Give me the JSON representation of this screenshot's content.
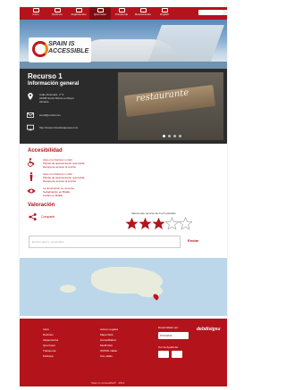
{
  "nav": {
    "items": [
      {
        "label": "Inicio",
        "icon": "home-icon"
      },
      {
        "label": "Destinos",
        "icon": "map-icon"
      },
      {
        "label": "Alojamientos",
        "icon": "bed-icon"
      },
      {
        "label": "Qué hacer",
        "icon": "camera-icon",
        "active": true
      },
      {
        "label": "Transporte",
        "icon": "car-icon"
      },
      {
        "label": "Restaurantes",
        "icon": "restaurant-icon"
      },
      {
        "label": "English",
        "icon": "flag-icon"
      }
    ]
  },
  "logo": {
    "line1": "SPAIN IS",
    "line2": "ACCESSIBLE"
  },
  "resource": {
    "title": "Recurso 1",
    "info_heading": "Información general",
    "address_line1": "Calle Alcantara, nº 3",
    "address_line2": "24098 Santa María La Mayor",
    "address_line3": "Alicante",
    "email": "email@email.com",
    "web": "http://www.misuebtaquesea.com",
    "photo_text": "restaurante"
  },
  "accessibility": {
    "heading": "Accesibilidad",
    "items": [
      {
        "icon": "wheelchair-icon",
        "lines": [
          "Aseo con barrera o más!",
          "Plazas de aparcamiento reservada",
          "Rampa de acceso al recinto"
        ]
      },
      {
        "icon": "person-icon",
        "lines": [
          "Aseo con barrera o más!",
          "Plazas de aparcamiento reservada",
          "Rampa de acceso al recinto"
        ]
      },
      {
        "icon": "eye-icon",
        "lines": [
          "La iluminación es correcta",
          "Señalización en Braille",
          "Cartas en Braille"
        ]
      }
    ]
  },
  "rating": {
    "heading": "Valoración",
    "share_label": "Compartir",
    "prompt": "Valora este recurso de 0 a 5 estrellas",
    "value": 3,
    "max": 5
  },
  "comment": {
    "placeholder": "Escribe aquí tu comentario",
    "send_label": "Enviar"
  },
  "footer": {
    "col1": [
      "Inicio",
      "Destinos",
      "Alojamientos",
      "Qué hacer",
      "Transporte",
      "Participa"
    ],
    "col2": [
      "Avisos Legales",
      "Mapa Web",
      "Accesibilidad",
      "Modif AAA",
      "W3TML válido",
      "Css válido"
    ],
    "developed_by_label": "Desarrollado por:",
    "developer": "DISCEMA",
    "help_label": "Con la Ayuda de:",
    "brand": "debdisigsu",
    "copyright": "Spain is Accessible® · 2014"
  },
  "colors": {
    "accent": "#b3141c",
    "dark": "#2b2b2b"
  }
}
